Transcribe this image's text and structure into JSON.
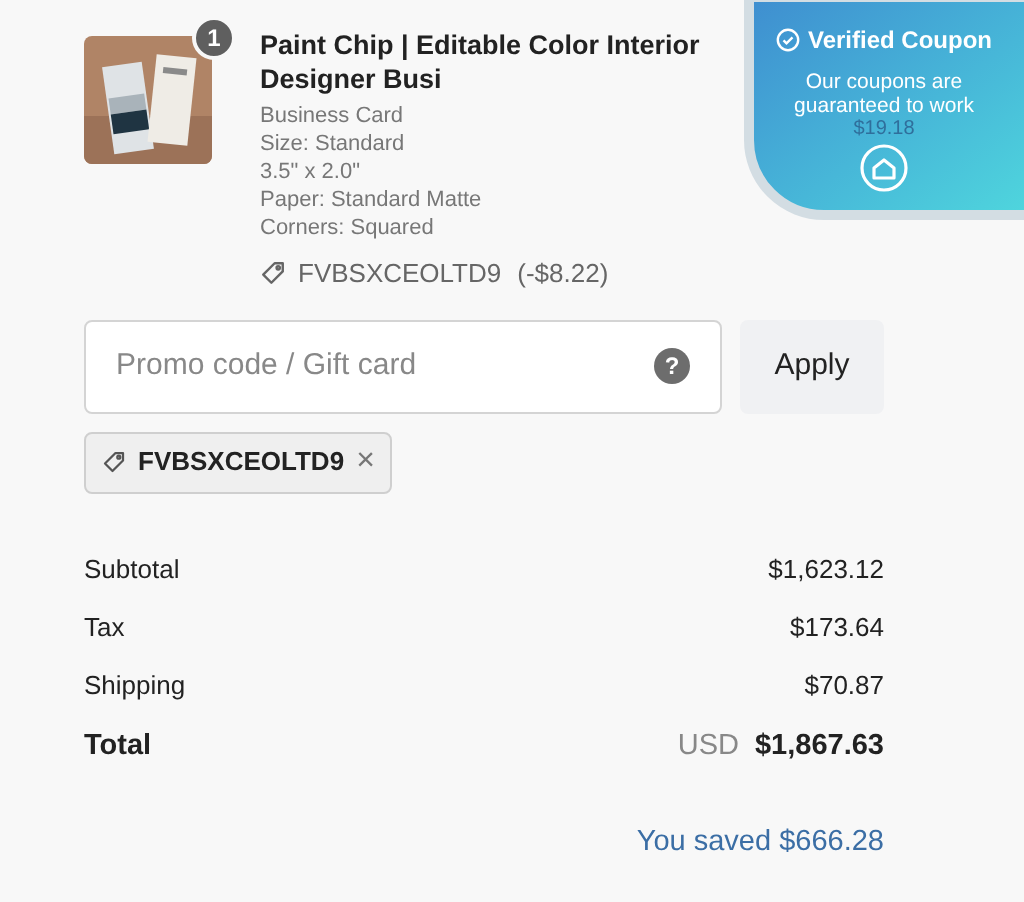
{
  "item": {
    "quantity": "1",
    "title": "Paint Chip | Editable Color Interior Designer Busi",
    "details": [
      "Business Card",
      "Size: Standard",
      "3.5\" x 2.0\"",
      "Paper: Standard Matte",
      "Corners: Squared"
    ],
    "coupon": "FVBSXCEOLTD9",
    "discount": "(-$8.22)",
    "price": "$19.18"
  },
  "promo": {
    "placeholder": "Promo code / Gift card",
    "help": "?",
    "apply": "Apply"
  },
  "applied_code": {
    "code": "FVBSXCEOLTD9",
    "remove": "×"
  },
  "summary": [
    {
      "kind": "line",
      "label": "Subtotal",
      "value": "$1,623.12"
    },
    {
      "kind": "line",
      "label": "Tax",
      "value": "$173.64"
    },
    {
      "kind": "line",
      "label": "Shipping",
      "value": "$70.87"
    },
    {
      "kind": "total",
      "label": "Total",
      "currency": "USD",
      "value": "$1,867.63"
    }
  ],
  "savings": "You saved $666.28",
  "overlay": {
    "title": "Verified Coupon",
    "text": "Our coupons are guaranteed to work"
  }
}
